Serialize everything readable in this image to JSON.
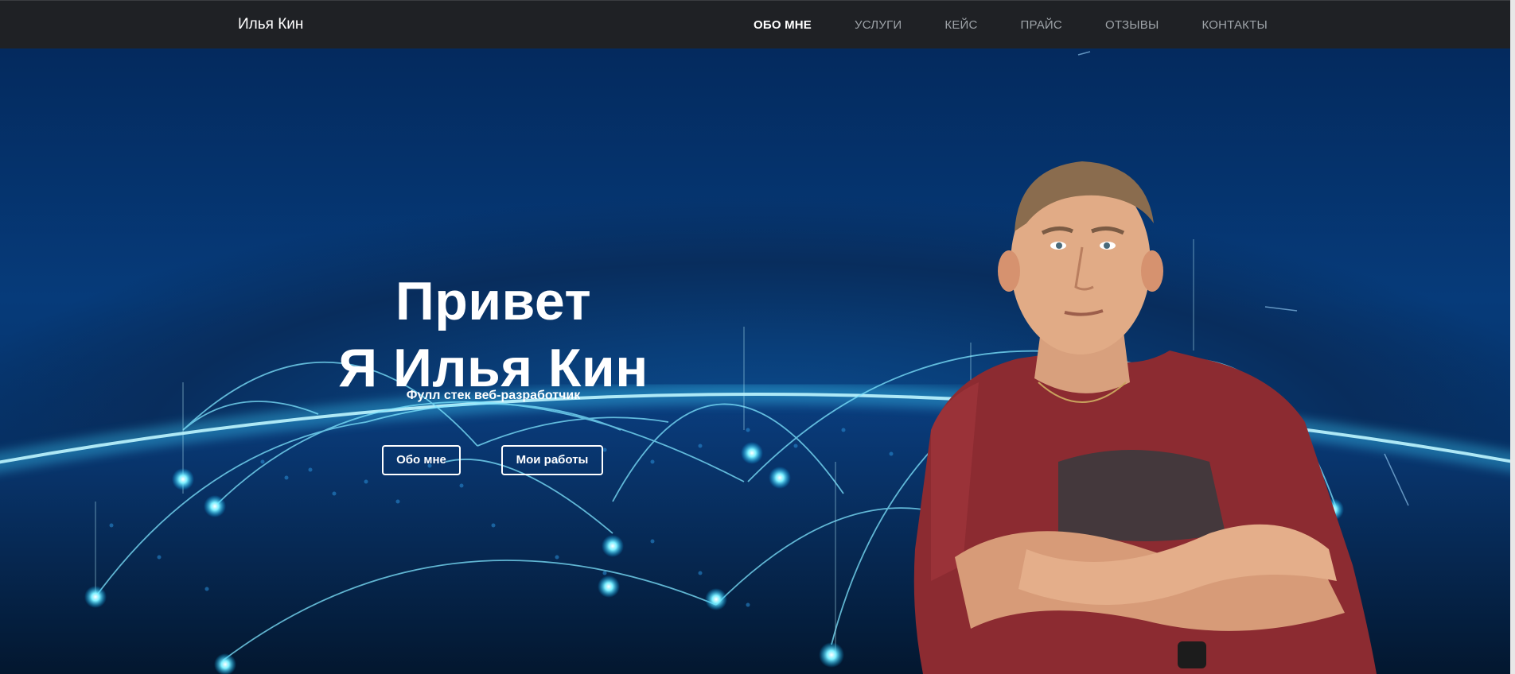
{
  "navbar": {
    "brand": "Илья Кин",
    "items": [
      {
        "label": "ОБО МНЕ",
        "active": true
      },
      {
        "label": "УСЛУГИ",
        "active": false
      },
      {
        "label": "КЕЙС",
        "active": false
      },
      {
        "label": "ПРАЙС",
        "active": false
      },
      {
        "label": "ОТЗЫВЫ",
        "active": false
      },
      {
        "label": "КОНТАКТЫ",
        "active": false
      }
    ]
  },
  "hero": {
    "title_line1": "Привет",
    "title_line2": "Я Илья Кин",
    "subtitle": "Фулл стек веб-разработчик",
    "button_about": "Обо мне",
    "button_works": "Мои работы",
    "background": "globe-network-image",
    "portrait": "person-photo"
  },
  "colors": {
    "navbar_bg": "#1f2125",
    "nav_text": "#9ea3a8",
    "nav_active": "#ffffff",
    "hero_bg": "#063b7a",
    "glow": "#4fd8ff",
    "shirt": "#8a2a30"
  }
}
